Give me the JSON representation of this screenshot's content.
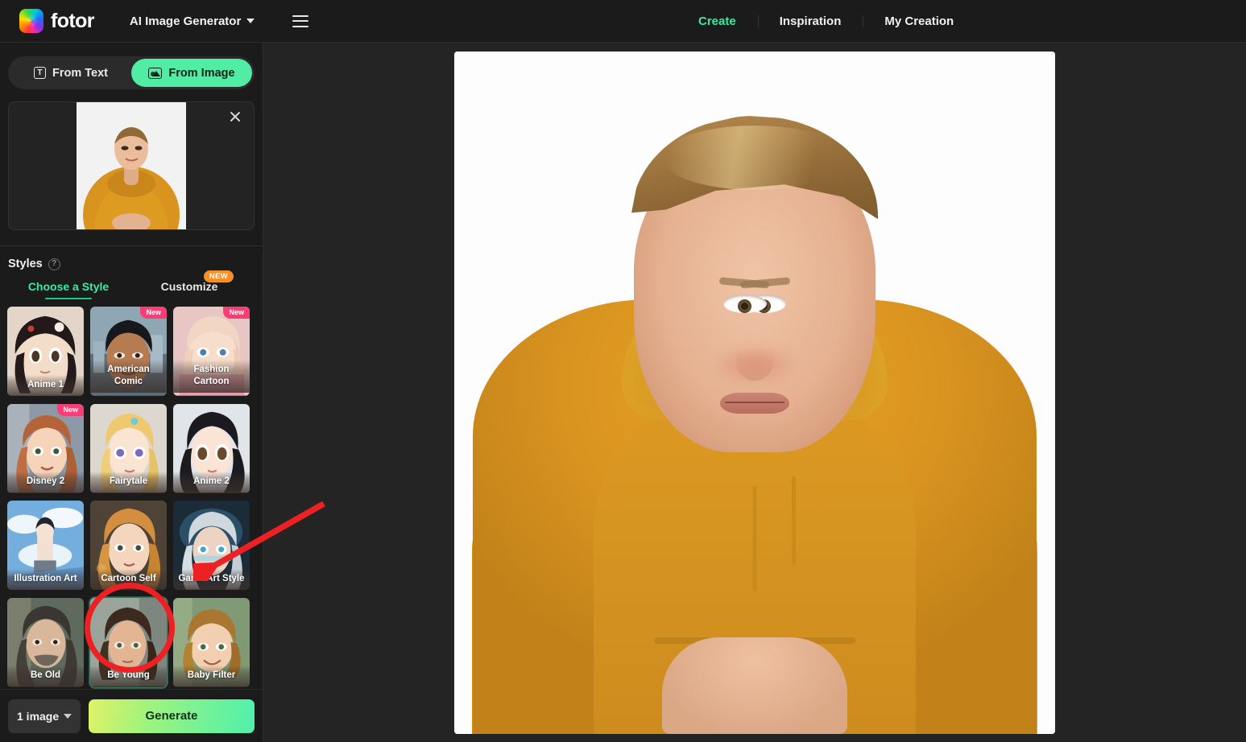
{
  "topbar": {
    "logo_text": "fotor",
    "logo_icon": "rainbow-square-logo",
    "app_switcher": "AI Image Generator",
    "app_switcher_icon": "chevron-down-icon",
    "menu_icon": "hamburger-menu-icon",
    "nav": [
      {
        "label": "Create",
        "active": true
      },
      {
        "label": "Inspiration",
        "active": false
      },
      {
        "label": "My Creation",
        "active": false
      }
    ],
    "accent_green": "#3de8a5"
  },
  "sidebar": {
    "mode_toggle": {
      "from_text": {
        "label": "From Text",
        "icon": "text-box-icon",
        "active": false
      },
      "from_image": {
        "label": "From Image",
        "icon": "image-icon",
        "active": true
      }
    },
    "upload": {
      "close_icon": "close-icon",
      "thumbnail_alt": "uploaded-photo-man-in-orange-hoodie"
    },
    "styles": {
      "title": "Styles",
      "help_icon": "help-circle-icon",
      "tabs": [
        {
          "label": "Choose a Style",
          "active": true,
          "badge": null
        },
        {
          "label": "Customize",
          "active": false,
          "badge": "NEW"
        }
      ],
      "badge_color": "#f59026",
      "cards": [
        {
          "label": "Anime 1",
          "badge": null,
          "selected": false
        },
        {
          "label": "American Comic",
          "badge": "New",
          "selected": false
        },
        {
          "label": "Fashion Cartoon",
          "badge": "New",
          "selected": false
        },
        {
          "label": "Disney 2",
          "badge": "New",
          "selected": false
        },
        {
          "label": "Fairytale",
          "badge": null,
          "selected": false
        },
        {
          "label": "Anime 2",
          "badge": null,
          "selected": false
        },
        {
          "label": "Illustration Art",
          "badge": null,
          "selected": false
        },
        {
          "label": "Cartoon Self",
          "badge": null,
          "selected": false
        },
        {
          "label": "Game Art Style",
          "badge": null,
          "selected": false
        },
        {
          "label": "Be Old",
          "badge": null,
          "selected": false
        },
        {
          "label": "Be Young",
          "badge": null,
          "selected": true
        },
        {
          "label": "Baby Filter",
          "badge": null,
          "selected": false
        }
      ],
      "card_badge_color": "#fb3d77"
    },
    "footer": {
      "image_count": "1 image",
      "count_chevron_icon": "chevron-down-icon",
      "generate_label": "Generate"
    }
  },
  "canvas": {
    "result_alt": "generated-portrait-young-boy-orange-hoodie"
  },
  "annotations": {
    "circle_color": "#ed2024",
    "arrow_color": "#ed2024"
  }
}
